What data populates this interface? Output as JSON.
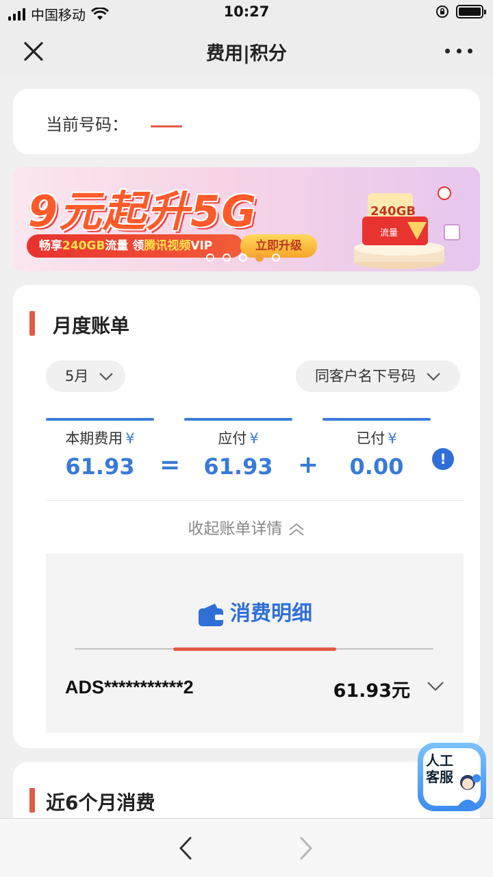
{
  "status_bar": {
    "carrier": "中国移动",
    "time": "10:27"
  },
  "nav": {
    "title": "费用|积分"
  },
  "number_card": {
    "label": "当前号码："
  },
  "banner": {
    "headline": "9元起升5G",
    "pill_prefix": "畅享",
    "pill_highlight1": "240GB",
    "pill_mid": "流量 领",
    "pill_highlight2": "腾讯视频",
    "pill_suffix": "VIP",
    "cta": "立即升级",
    "art_tag": "240GB",
    "art_label": "流量",
    "slide_count": 5,
    "active_slide": 4
  },
  "monthly_bill": {
    "title": "月度账单",
    "month_select": "5月",
    "number_scope_select": "同客户名下号码",
    "currency": "¥",
    "current_fee_label": "本期费用",
    "current_fee": "61.93",
    "equals": "=",
    "due_label": "应付",
    "due": "61.93",
    "plus": "+",
    "paid_label": "已付",
    "paid": "0.00",
    "collapse_label": "收起账单详情",
    "detail": {
      "title": "消费明细",
      "account": "ADS***********2",
      "amount": "61.93元"
    }
  },
  "recent_section": {
    "title": "近6个月消费"
  },
  "service_float": {
    "label": "人工客服"
  },
  "colors": {
    "accent_blue": "#3a7ad6",
    "accent_red": "#e25b45"
  }
}
